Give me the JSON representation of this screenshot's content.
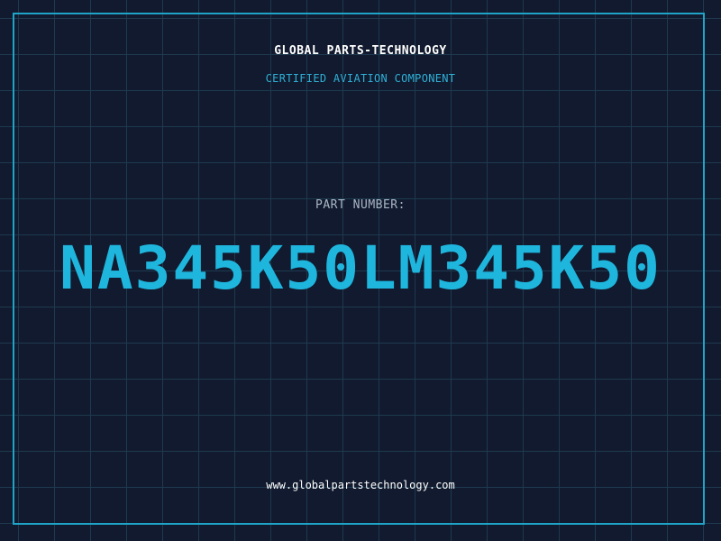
{
  "header": {
    "company": "GLOBAL PARTS-TECHNOLOGY",
    "tagline": "CERTIFIED AVIATION COMPONENT"
  },
  "part": {
    "label": "PART NUMBER:",
    "number": "NA345K50LM345K50"
  },
  "footer": {
    "url": "www.globalpartstechnology.com"
  },
  "colors": {
    "background": "#111a2e",
    "grid": "#1e3a4f",
    "accent": "#1fb6de",
    "text": "#ffffff"
  }
}
